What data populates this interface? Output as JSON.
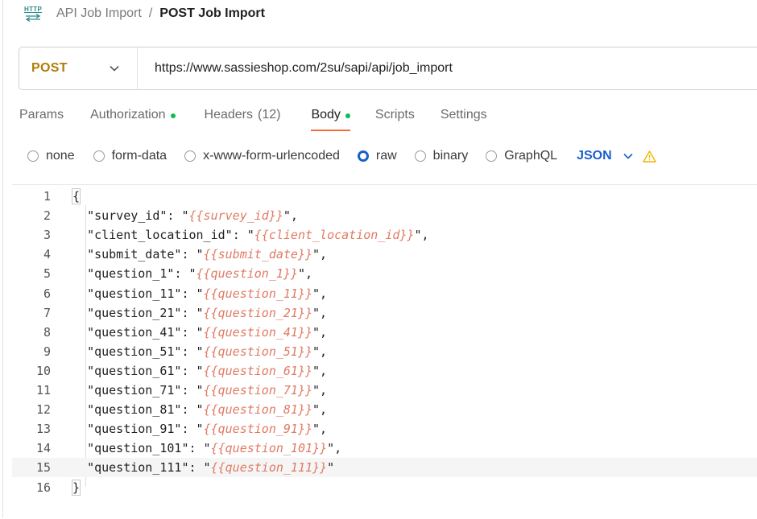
{
  "breadcrumb": {
    "parent": "API Job Import",
    "separator": "/",
    "current": "POST Job Import",
    "icon_text": "HTTP"
  },
  "request": {
    "method": "POST",
    "url": "https://www.sassieshop.com/2su/sapi/api/job_import"
  },
  "tabs": [
    {
      "label": "Params",
      "count": "",
      "dot": false,
      "active": false
    },
    {
      "label": "Authorization",
      "count": "",
      "dot": true,
      "active": false
    },
    {
      "label": "Headers",
      "count": "(12)",
      "dot": false,
      "active": false
    },
    {
      "label": "Body",
      "count": "",
      "dot": true,
      "active": true
    },
    {
      "label": "Scripts",
      "count": "",
      "dot": false,
      "active": false
    },
    {
      "label": "Settings",
      "count": "",
      "dot": false,
      "active": false
    }
  ],
  "body_types": [
    {
      "label": "none",
      "selected": false
    },
    {
      "label": "form-data",
      "selected": false
    },
    {
      "label": "x-www-form-urlencoded",
      "selected": false
    },
    {
      "label": "raw",
      "selected": true
    },
    {
      "label": "binary",
      "selected": false
    },
    {
      "label": "GraphQL",
      "selected": false
    }
  ],
  "format": "JSON",
  "colors": {
    "method": "#b07d07",
    "accent": "#f26b3a",
    "dot": "#0cbb52",
    "select": "#1b5fcc",
    "template": "#e07a63",
    "warning": "#f0b400"
  },
  "editor": {
    "current_line": 15,
    "lines": [
      {
        "n": "1",
        "type": "brace",
        "text": "{"
      },
      {
        "n": "2",
        "type": "pair",
        "key": "survey_id",
        "value": "{{survey_id}}",
        "comma": true
      },
      {
        "n": "3",
        "type": "pair",
        "key": "client_location_id",
        "value": "{{client_location_id}}",
        "comma": true
      },
      {
        "n": "4",
        "type": "pair",
        "key": "submit_date",
        "value": "{{submit_date}}",
        "comma": true
      },
      {
        "n": "5",
        "type": "pair",
        "key": "question_1",
        "value": "{{question_1}}",
        "comma": true
      },
      {
        "n": "6",
        "type": "pair",
        "key": "question_11",
        "value": "{{question_11}}",
        "comma": true
      },
      {
        "n": "7",
        "type": "pair",
        "key": "question_21",
        "value": "{{question_21}}",
        "comma": true
      },
      {
        "n": "8",
        "type": "pair",
        "key": "question_41",
        "value": "{{question_41}}",
        "comma": true
      },
      {
        "n": "9",
        "type": "pair",
        "key": "question_51",
        "value": "{{question_51}}",
        "comma": true
      },
      {
        "n": "10",
        "type": "pair",
        "key": "question_61",
        "value": "{{question_61}}",
        "comma": true
      },
      {
        "n": "11",
        "type": "pair",
        "key": "question_71",
        "value": "{{question_71}}",
        "comma": true
      },
      {
        "n": "12",
        "type": "pair",
        "key": "question_81",
        "value": "{{question_81}}",
        "comma": true
      },
      {
        "n": "13",
        "type": "pair",
        "key": "question_91",
        "value": "{{question_91}}",
        "comma": true
      },
      {
        "n": "14",
        "type": "pair",
        "key": "question_101",
        "value": "{{question_101}}",
        "comma": true
      },
      {
        "n": "15",
        "type": "pair",
        "key": "question_111",
        "value": "{{question_111}}",
        "comma": false
      },
      {
        "n": "16",
        "type": "brace",
        "text": "}"
      }
    ]
  }
}
